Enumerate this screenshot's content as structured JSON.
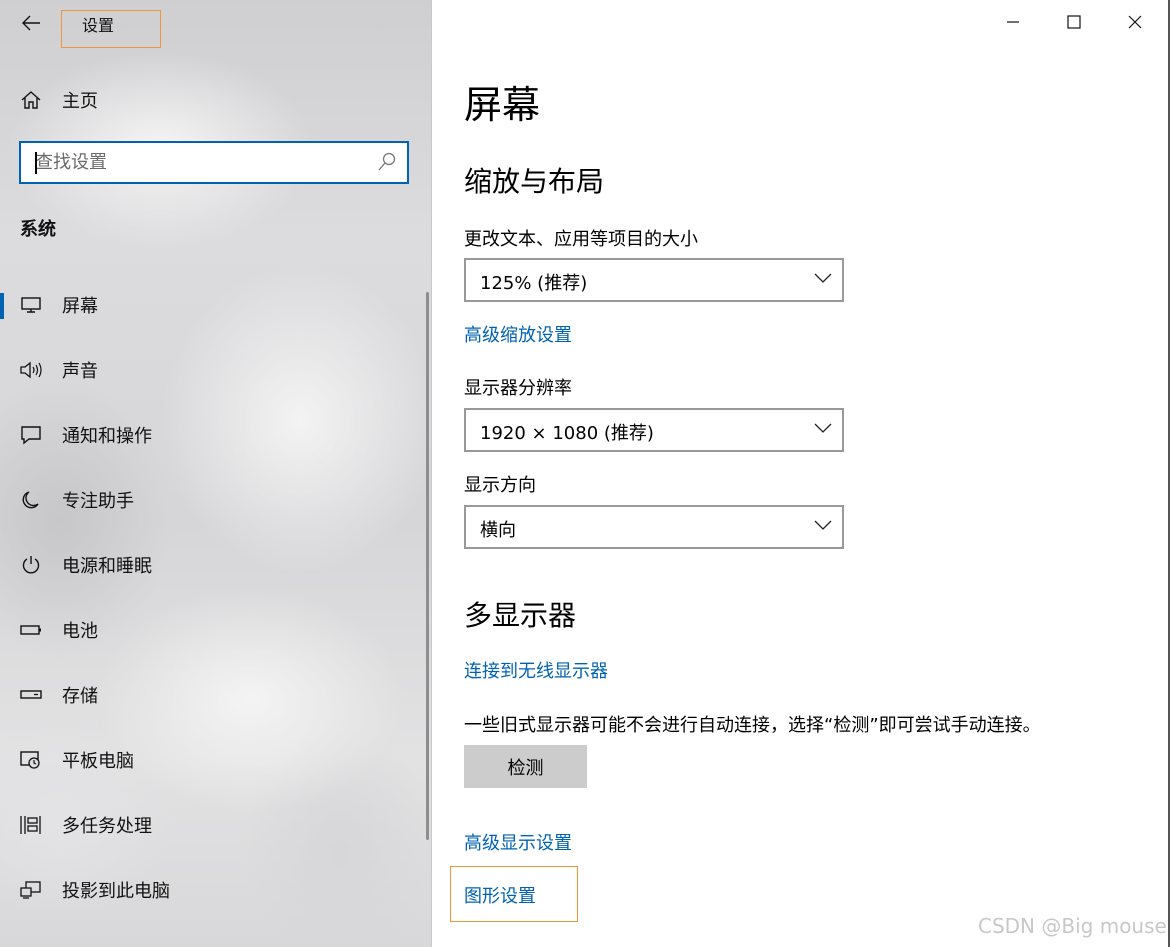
{
  "window": {
    "app_title": "设置",
    "controls": {
      "minimize": "—",
      "maximize": "☐",
      "close": "✕"
    }
  },
  "sidebar": {
    "home_label": "主页",
    "search": {
      "placeholder": "查找设置"
    },
    "section_label": "系统",
    "items": [
      {
        "label": "屏幕",
        "icon": "monitor-icon",
        "selected": true
      },
      {
        "label": "声音",
        "icon": "speaker-icon",
        "selected": false
      },
      {
        "label": "通知和操作",
        "icon": "notification-icon",
        "selected": false
      },
      {
        "label": "专注助手",
        "icon": "moon-icon",
        "selected": false
      },
      {
        "label": "电源和睡眠",
        "icon": "power-icon",
        "selected": false
      },
      {
        "label": "电池",
        "icon": "battery-icon",
        "selected": false
      },
      {
        "label": "存储",
        "icon": "storage-icon",
        "selected": false
      },
      {
        "label": "平板电脑",
        "icon": "tablet-icon",
        "selected": false
      },
      {
        "label": "多任务处理",
        "icon": "multitask-icon",
        "selected": false
      },
      {
        "label": "投影到此电脑",
        "icon": "project-icon",
        "selected": false
      }
    ]
  },
  "main": {
    "page_title": "屏幕",
    "scale_section": {
      "heading": "缩放与布局",
      "scale_label": "更改文本、应用等项目的大小",
      "scale_value": "125% (推荐)",
      "advanced_scale_link": "高级缩放设置",
      "resolution_label": "显示器分辨率",
      "resolution_value": "1920 × 1080 (推荐)",
      "orientation_label": "显示方向",
      "orientation_value": "横向"
    },
    "multi_display": {
      "heading": "多显示器",
      "wireless_link": "连接到无线显示器",
      "description": "一些旧式显示器可能不会进行自动连接，选择“检测”即可尝试手动连接。",
      "detect_button": "检测",
      "advanced_display_link": "高级显示设置",
      "graphics_link": "图形设置"
    }
  },
  "watermark": "CSDN @Big mouse",
  "colors": {
    "accent": "#0063b1",
    "highlight_box": "#f0953a"
  }
}
